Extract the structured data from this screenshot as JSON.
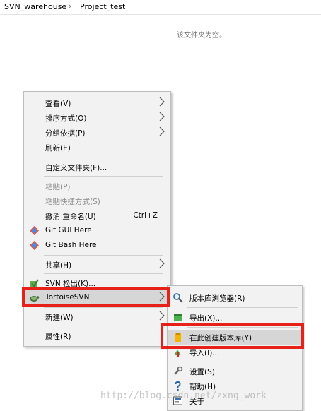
{
  "breadcrumb": {
    "items": [
      "SVN_warehouse",
      "Project_test"
    ],
    "separator": "›"
  },
  "folder": {
    "empty_message": "该文件夹为空。"
  },
  "context_menu": {
    "items": [
      {
        "label": "查看(V)",
        "submenu": true
      },
      {
        "label": "排序方式(O)",
        "submenu": true
      },
      {
        "label": "分组依据(P)",
        "submenu": true
      },
      {
        "label": "刷新(E)"
      },
      {
        "label": "自定义文件夹(F)..."
      },
      {
        "label": "粘贴(P)",
        "disabled": true
      },
      {
        "label": "粘贴快捷方式(S)",
        "disabled": true
      },
      {
        "label": "撤消 重命名(U)",
        "shortcut": "Ctrl+Z"
      },
      {
        "label": "Git GUI Here",
        "icon": "git-icon"
      },
      {
        "label": "Git Bash Here",
        "icon": "git-icon"
      },
      {
        "label": "共享(H)",
        "submenu": true
      },
      {
        "label": "SVN 检出(K)...",
        "icon": "svn-checkout-icon"
      },
      {
        "label": "TortoiseSVN",
        "icon": "tortoise-icon",
        "submenu": true,
        "highlighted": true
      },
      {
        "label": "新建(W)",
        "submenu": true
      },
      {
        "label": "属性(R)"
      }
    ]
  },
  "tortoise_submenu": {
    "items": [
      {
        "label": "版本库浏览器(R)",
        "icon": "repo-browser-icon"
      },
      {
        "label": "导出(X)...",
        "icon": "export-icon"
      },
      {
        "label": "在此创建版本库(Y)",
        "icon": "create-repo-icon",
        "highlighted": true
      },
      {
        "label": "导入(I)...",
        "icon": "import-icon"
      },
      {
        "label": "设置(S)",
        "icon": "settings-icon"
      },
      {
        "label": "帮助(H)",
        "icon": "help-icon"
      },
      {
        "label": "关于",
        "icon": "about-icon"
      }
    ]
  },
  "watermark": "http://blog.csdn.net/zxng_work",
  "colors": {
    "annotation_red": "#e8201a",
    "menu_bg": "#f2f2f2",
    "highlight_bg": "#d6d6d6"
  }
}
